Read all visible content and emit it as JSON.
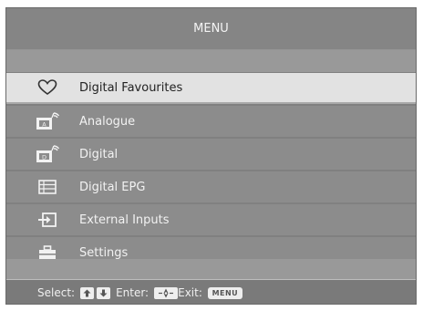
{
  "title": "MENU",
  "menu": {
    "items": [
      {
        "label": "Digital Favourites",
        "icon": "heart-icon",
        "selected": true
      },
      {
        "label": "Analogue",
        "icon": "analogue-antenna-icon",
        "selected": false
      },
      {
        "label": "Digital",
        "icon": "digital-antenna-icon",
        "selected": false
      },
      {
        "label": "Digital EPG",
        "icon": "epg-list-icon",
        "selected": false
      },
      {
        "label": "External Inputs",
        "icon": "input-arrow-icon",
        "selected": false
      },
      {
        "label": "Settings",
        "icon": "toolbox-icon",
        "selected": false
      }
    ],
    "icon_glyphs": {
      "analogue": "A",
      "digital": "D"
    }
  },
  "footer": {
    "select_label": "Select:",
    "enter_label": "Enter:",
    "exit_label": "Exit:",
    "menu_key": "MENU",
    "up_key": "up-arrow-icon",
    "down_key": "down-arrow-icon",
    "enter_key": "enter-key-icon"
  },
  "colors": {
    "panel": "#808080",
    "selected_row": "#e2e2e2",
    "text": "#f2f2f2"
  }
}
